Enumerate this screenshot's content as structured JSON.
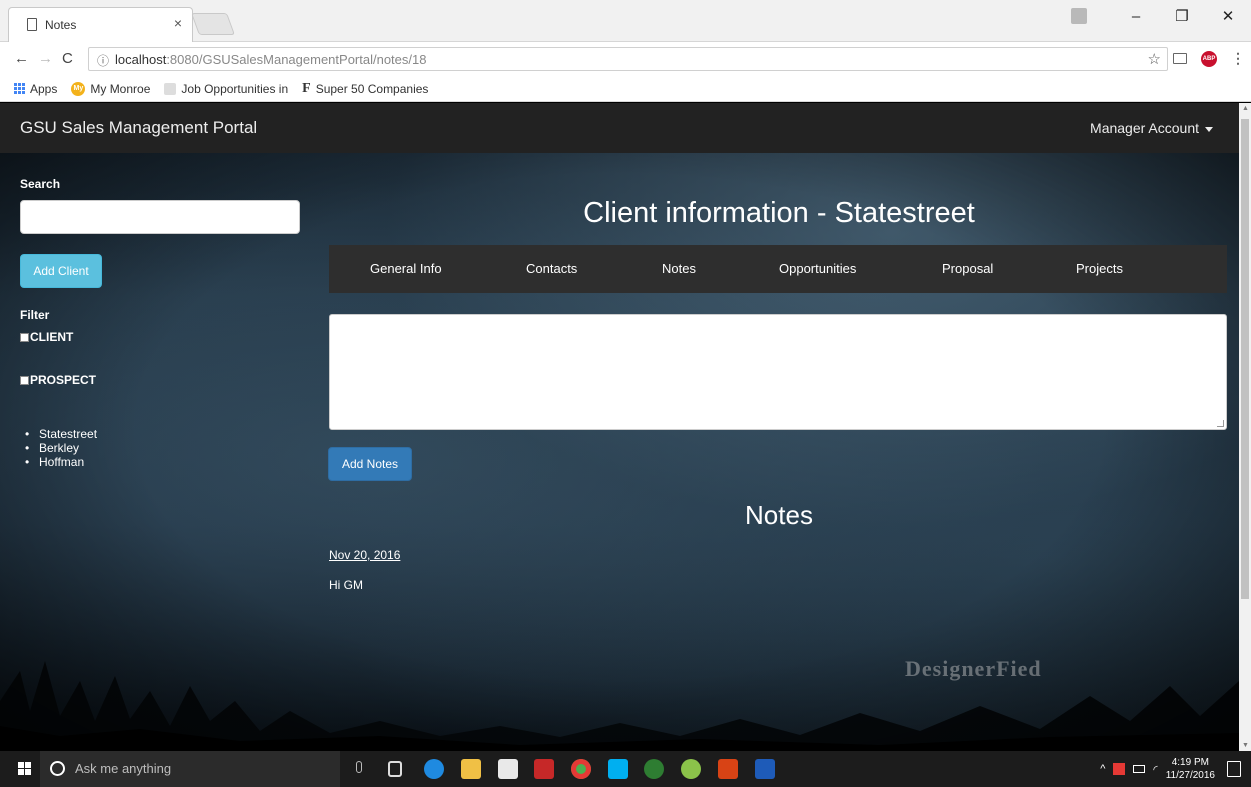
{
  "browser": {
    "tab_title": "Notes",
    "tab_close": "×",
    "url_host": "localhost",
    "url_path": ":8080/GSUSalesManagementPortal/notes/18",
    "bookmarks": {
      "apps": "Apps",
      "my_monroe": "My Monroe",
      "my_monroe_icon": "My",
      "job": "Job Opportunities in",
      "super50_icon": "F",
      "super50": "Super 50 Companies"
    }
  },
  "navbar": {
    "brand": "GSU Sales Management Portal",
    "account": "Manager Account"
  },
  "sidebar": {
    "search_label": "Search",
    "add_client": "Add Client",
    "filter_label": "Filter",
    "filters": [
      "CLIENT",
      "PROSPECT"
    ],
    "clients": [
      "Statestreet",
      "Berkley",
      "Hoffman"
    ]
  },
  "main": {
    "title": "Client information - Statestreet",
    "tabs": [
      "General Info",
      "Contacts",
      "Notes",
      "Opportunities",
      "Proposal",
      "Projects"
    ],
    "add_notes": "Add Notes",
    "notes_heading": "Notes",
    "notes": [
      {
        "date": "Nov 20, 2016",
        "text": "Hi GM"
      }
    ],
    "watermark": "DesignerFied"
  },
  "taskbar": {
    "search_placeholder": "Ask me anything",
    "time": "4:19 PM",
    "date": "11/27/2016"
  },
  "colors": {
    "navbar_bg": "#222222",
    "add_client_btn": "#5bc0de",
    "add_notes_btn": "#337ab7",
    "tabs_bg": "#2e2e2e"
  }
}
